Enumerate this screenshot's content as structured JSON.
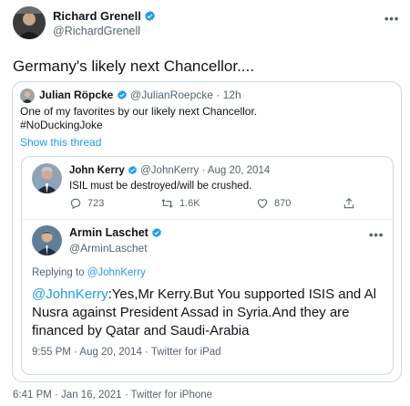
{
  "colors": {
    "accent": "#1d9bf0",
    "muted": "#536471",
    "text": "#0f1419",
    "border": "#cfd9de"
  },
  "main_tweet": {
    "author_name": "Richard Grenell",
    "author_handle": "@RichardGrenell",
    "text": "Germany's likely next Chancellor....",
    "meta": "6:41 PM · Jan 16, 2021 · Twitter for iPhone",
    "more_icon": "ellipsis-icon",
    "verified_icon": "verified-badge-icon"
  },
  "quoted_tweet": {
    "author_name": "Julian Röpcke",
    "author_handle": "@JulianRoepcke",
    "time": "· 12h",
    "text_line1": "One of my favorites by our likely next Chancellor.",
    "text_line2": "#NoDuckingJoke",
    "show_thread": "Show this thread"
  },
  "kerry_tweet": {
    "author_name": "John Kerry",
    "author_handle": "@JohnKerry",
    "date": "· Aug 20, 2014",
    "text": "ISIL must be destroyed/will be crushed.",
    "replies": "723",
    "retweets": "1.6K",
    "likes": "870"
  },
  "laschet_tweet": {
    "author_name": "Armin Laschet",
    "author_handle": "@ArminLaschet",
    "replying_prefix": "Replying to ",
    "replying_to": "@JohnKerry",
    "mention": "@JohnKerry",
    "text": ":Yes,Mr Kerry.But You supported ISIS and Al Nusra against President Assad in Syria.And they are financed by Qatar and Saudi-Arabia",
    "meta": "9:55 PM · Aug 20, 2014 · Twitter for iPad"
  }
}
